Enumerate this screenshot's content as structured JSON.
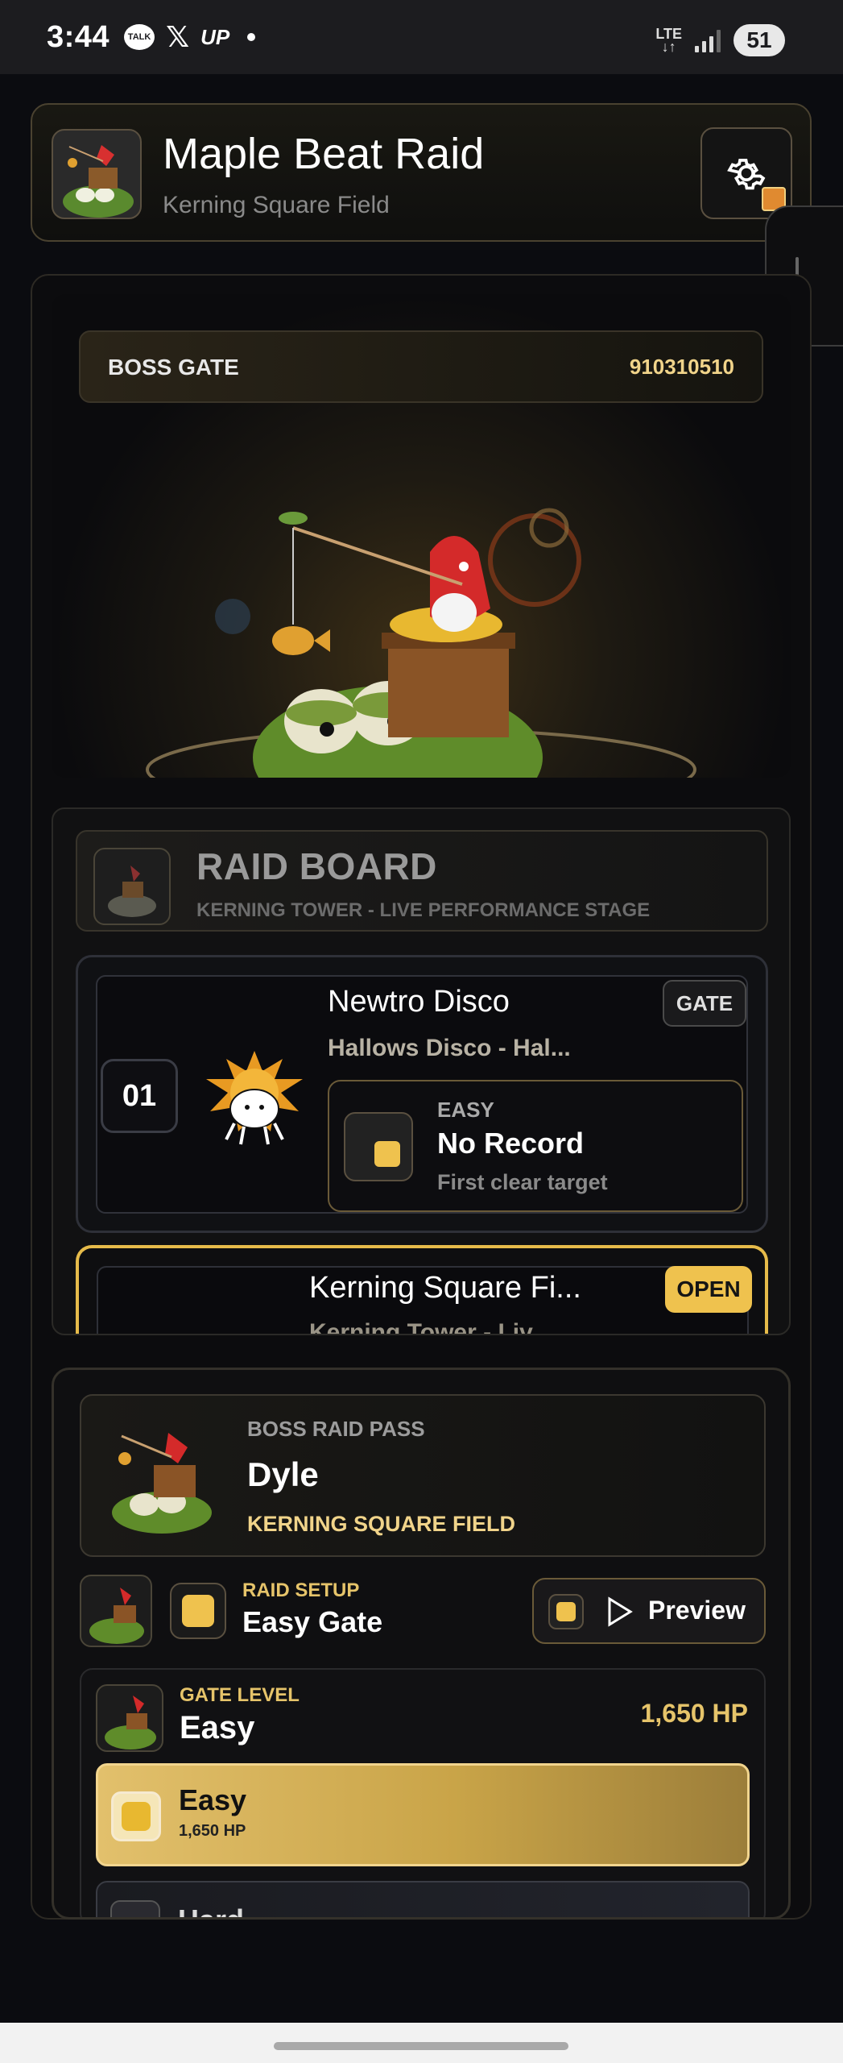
{
  "status_bar": {
    "time": "3:44",
    "talk": "TALK",
    "x": "𝕏",
    "up": "UP",
    "network": "LTE",
    "battery": "51"
  },
  "header": {
    "title": "Maple Beat Raid",
    "subtitle": "Kerning Square Field",
    "settings_icon": "gear-icon"
  },
  "boss_gate": {
    "label": "BOSS GATE",
    "code": "910310510"
  },
  "raid_board": {
    "title": "RAID BOARD",
    "subtitle": "KERNING TOWER - LIVE PERFORMANCE STAGE",
    "songs": [
      {
        "number": "01",
        "title": "Newtro Disco",
        "subtitle": "Hallows Disco - Hal...",
        "badge": "GATE",
        "difficulty": "EASY",
        "record": "No Record",
        "record_note": "First clear target"
      },
      {
        "title": "Kerning Square Fi...",
        "subtitle": "Kerning Tower - Liv...",
        "badge": "OPEN"
      }
    ]
  },
  "pass": {
    "label": "BOSS RAID PASS",
    "name": "Dyle",
    "location": "KERNING SQUARE FIELD"
  },
  "setup": {
    "label": "RAID SETUP",
    "value": "Easy Gate",
    "preview_label": "Preview"
  },
  "gate_level": {
    "label": "GATE LEVEL",
    "value": "Easy",
    "hp": "1,650 HP",
    "options": [
      {
        "title": "Easy",
        "hp": "1,650 HP"
      },
      {
        "title": "Hard"
      }
    ]
  },
  "colors": {
    "accent_gold": "#e6c46a",
    "open_badge": "#efc24e",
    "background": "#0b0c10"
  }
}
